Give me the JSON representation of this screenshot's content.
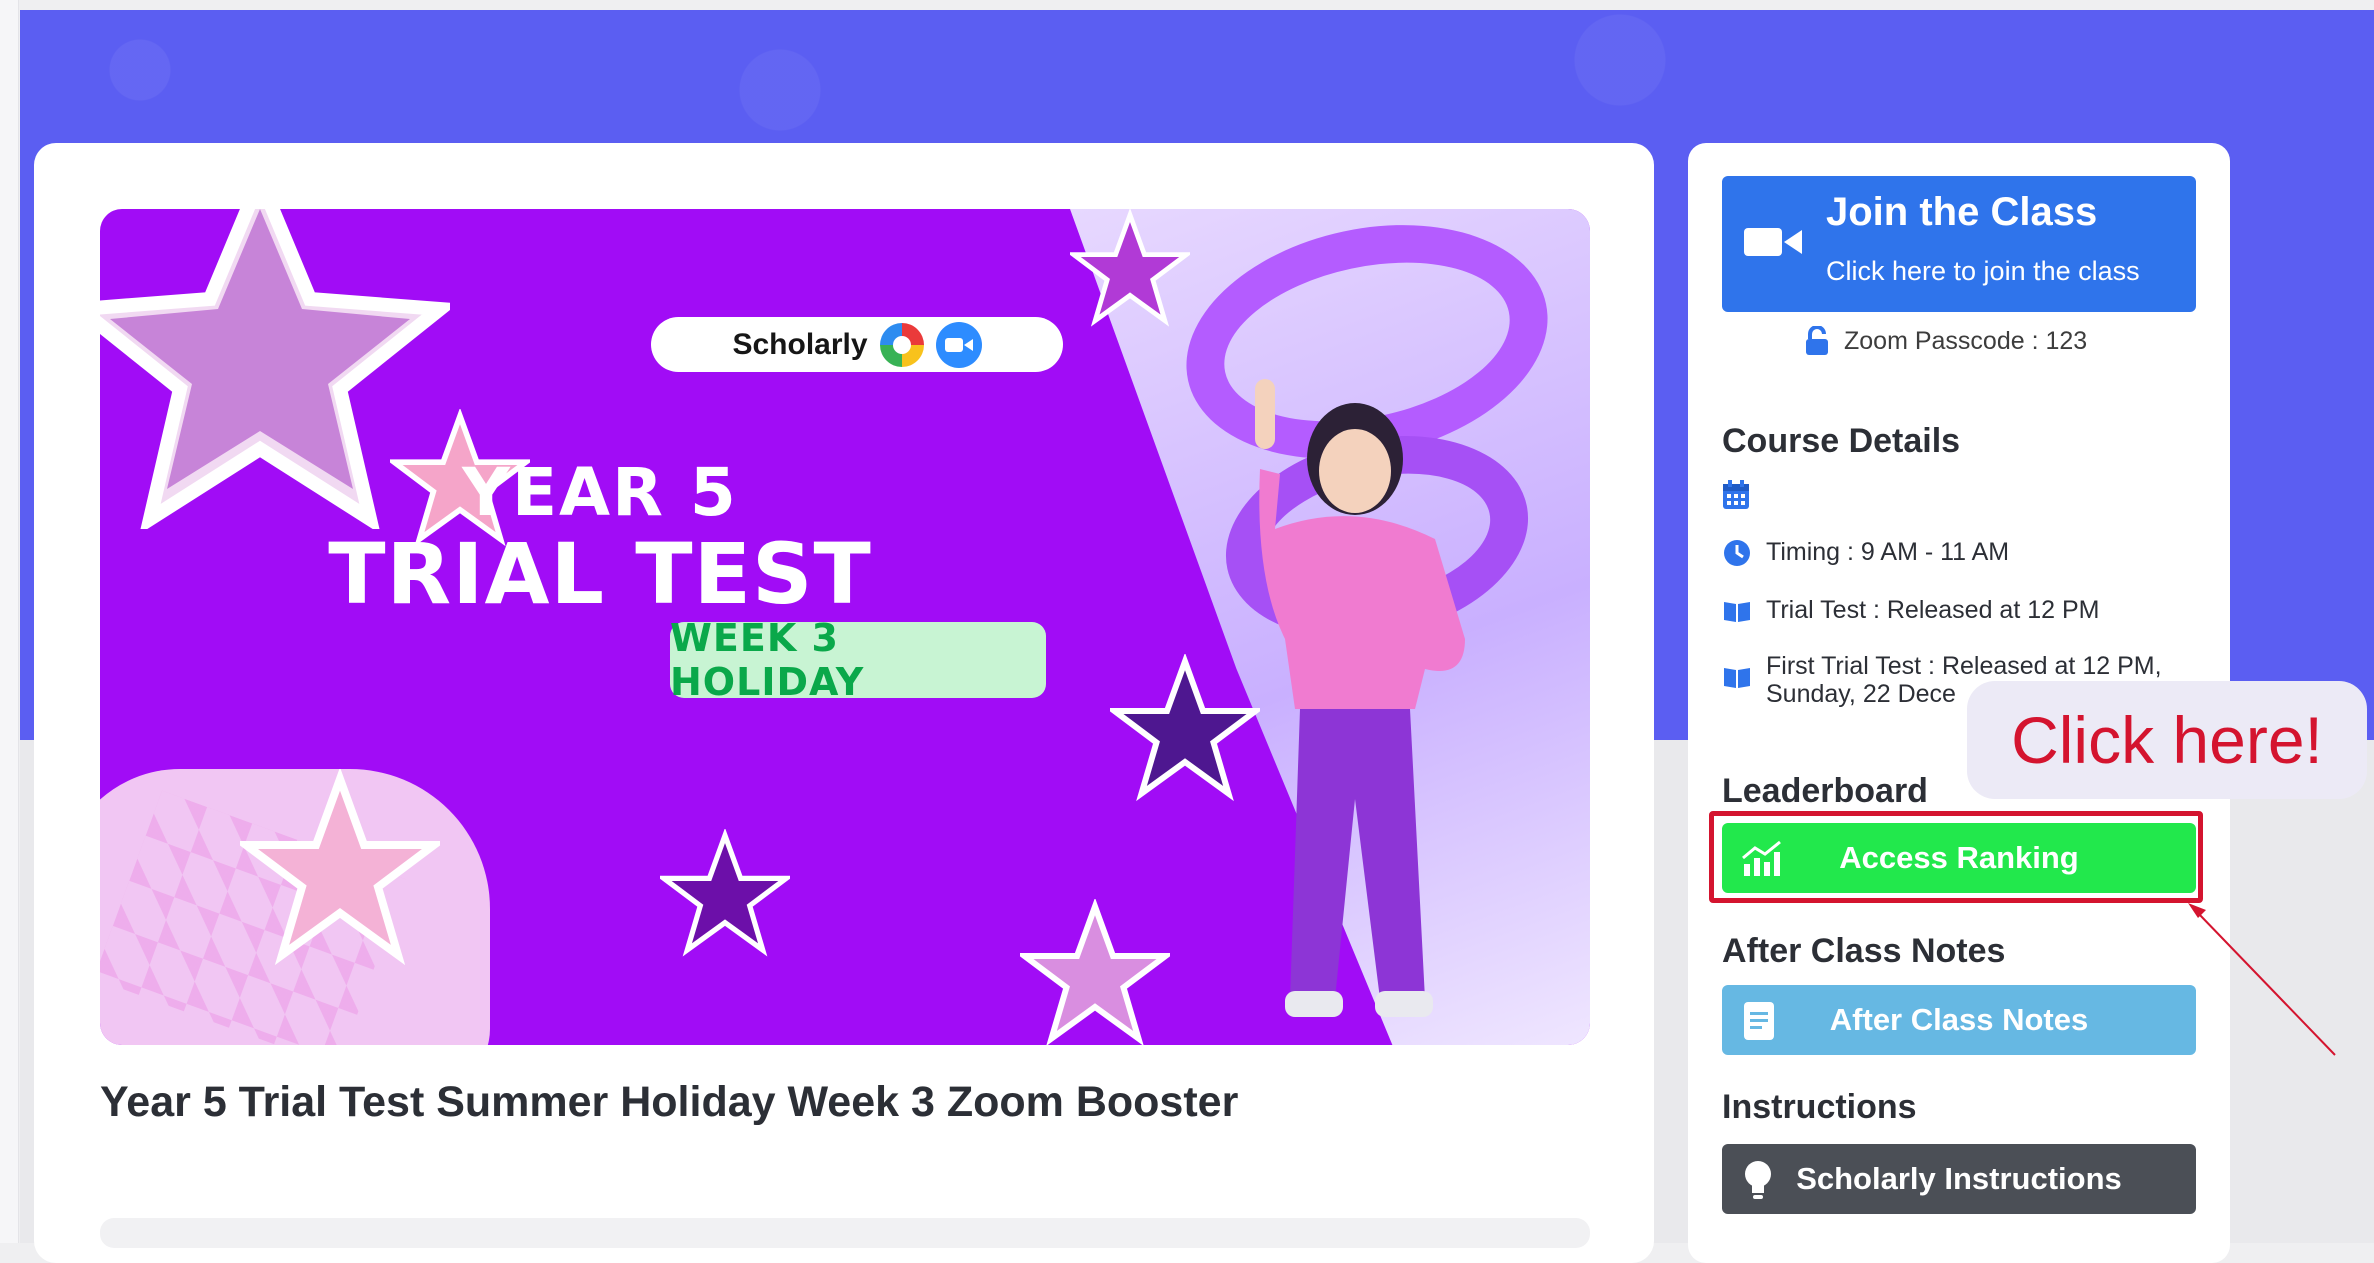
{
  "banner": {
    "logo_text": "Scholarly",
    "title_line1": "YEAR 5",
    "title_line2": "TRIAL TEST",
    "chip": "WEEK 3 HOLIDAY"
  },
  "course": {
    "title": "Year 5 Trial Test Summer Holiday Week 3 Zoom Booster"
  },
  "sidebar": {
    "join": {
      "title": "Join the Class",
      "subtitle": "Click here to join the class"
    },
    "passcode": "Zoom Passcode : 123",
    "course_details": {
      "heading": "Course Details",
      "timing": "Timing : 9 AM - 11 AM",
      "trial_test": "Trial Test : Released at 12 PM",
      "first_trial_line1": "First Trial Test : Released at 12 PM,",
      "first_trial_line2": "Sunday, 22 Dece"
    },
    "leaderboard": {
      "heading": "Leaderboard",
      "button": "Access Ranking"
    },
    "after_class": {
      "heading": "After Class Notes",
      "button": "After Class Notes"
    },
    "instructions": {
      "heading": "Instructions",
      "button": "Scholarly Instructions"
    }
  },
  "callout": {
    "text": "Click here!"
  },
  "colors": {
    "hero_bg": "#5b5ef2",
    "join_button": "#2f74eb",
    "ranking_button": "#22e84c",
    "notes_button": "#66b8e3",
    "instructions_button": "#4b4f56",
    "highlight": "#d4142f",
    "banner_purple": "#a10cf6"
  }
}
